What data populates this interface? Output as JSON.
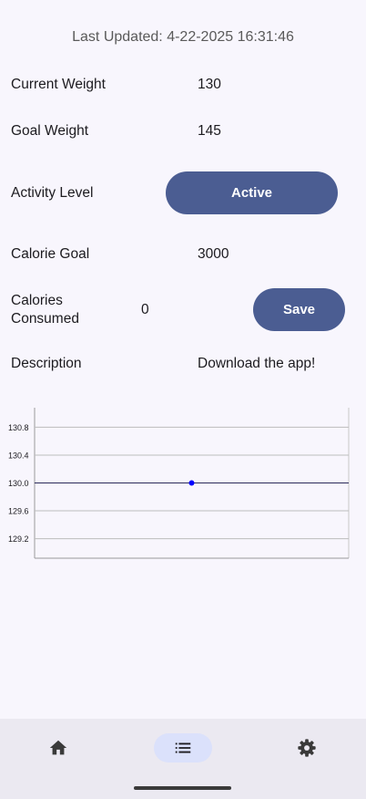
{
  "status": {
    "last_updated": "Last Updated: 4-22-2025 16:31:46"
  },
  "profile": {
    "current_weight_label": "Current Weight",
    "current_weight_value": "130",
    "goal_weight_label": "Goal Weight",
    "goal_weight_value": "145",
    "activity_label": "Activity Level",
    "activity_value": "Active",
    "calorie_goal_label": "Calorie Goal",
    "calorie_goal_value": "3000",
    "calories_consumed_label_line1": "Calories",
    "calories_consumed_label_line2": "Consumed",
    "calories_consumed_value": "0",
    "save_label": "Save",
    "description_label": "Description",
    "description_value": "Download the app!"
  },
  "chart_data": {
    "type": "line",
    "x": [
      0
    ],
    "series": [
      {
        "values": [
          130.0
        ],
        "color": "#0000ff"
      }
    ],
    "yticks": [
      "130.8",
      "130.4",
      "130.0",
      "129.6",
      "129.2"
    ],
    "ylim": [
      128.92,
      131.08
    ],
    "grid": true,
    "title": "",
    "xlabel": "",
    "ylabel": ""
  },
  "nav": {
    "items": [
      {
        "name": "home",
        "icon": "home-icon",
        "selected": false
      },
      {
        "name": "list",
        "icon": "list-icon",
        "selected": true
      },
      {
        "name": "settings",
        "icon": "gear-icon",
        "selected": false
      }
    ]
  },
  "colors": {
    "accent": "#4b5d92",
    "background": "#f8f6fd",
    "nav_selected": "#dbe1fb"
  }
}
